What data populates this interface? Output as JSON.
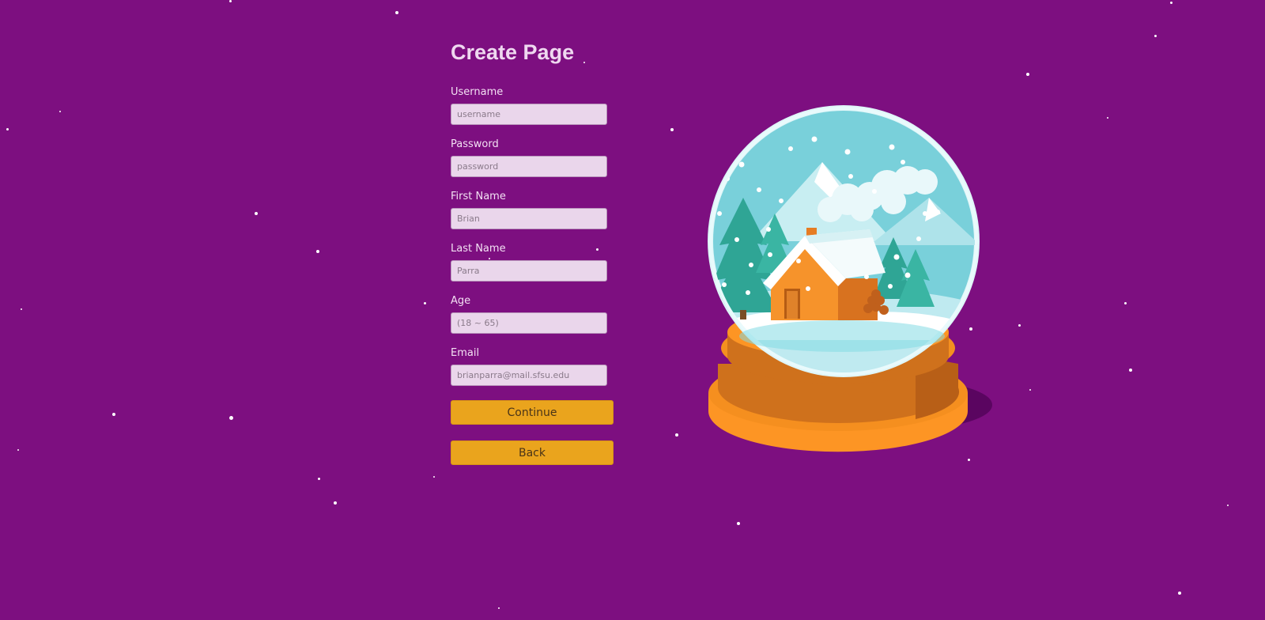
{
  "page": {
    "title": "Create Page"
  },
  "form": {
    "fields": [
      {
        "label": "Username",
        "placeholder": "username",
        "value": ""
      },
      {
        "label": "Password",
        "placeholder": "password",
        "value": ""
      },
      {
        "label": "First Name",
        "placeholder": "Brian",
        "value": ""
      },
      {
        "label": "Last Name",
        "placeholder": "Parra",
        "value": ""
      },
      {
        "label": "Age",
        "placeholder": "(18 ~ 65)",
        "value": ""
      },
      {
        "label": "Email",
        "placeholder": "brianparra@mail.sfsu.edu",
        "value": ""
      }
    ],
    "continue_label": "Continue",
    "back_label": "Back"
  },
  "illustration": {
    "icon": "snow-globe-cabin-icon"
  },
  "colors": {
    "background": "#7d0f80",
    "button": "#eaa41d",
    "input_background": "#ead6eb",
    "title": "#efd8f0"
  }
}
